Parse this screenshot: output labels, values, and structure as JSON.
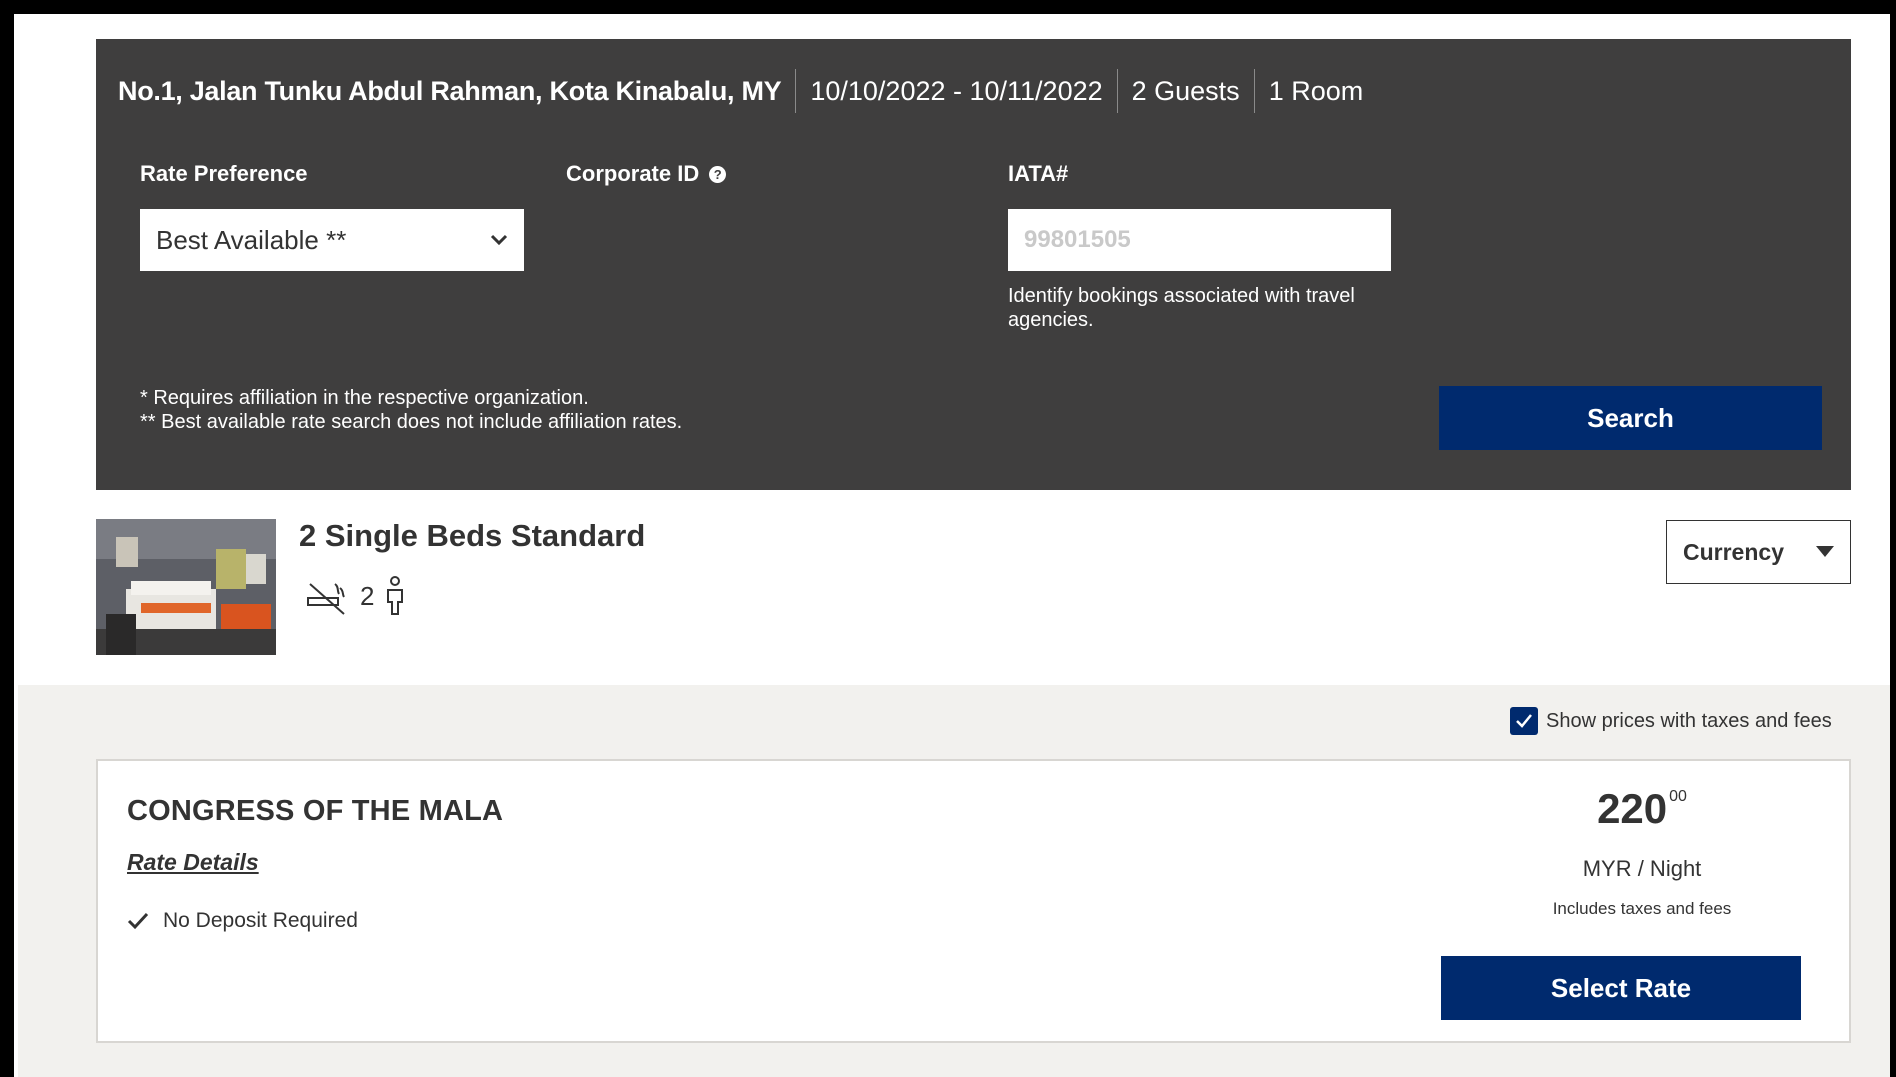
{
  "search": {
    "summary": {
      "address": "No.1, Jalan Tunku Abdul Rahman, Kota Kinabalu, MY",
      "dates": "10/10/2022 - 10/11/2022",
      "guests": "2 Guests",
      "rooms": "1 Room"
    },
    "rate_preference": {
      "label": "Rate Preference",
      "value": "Best Available **"
    },
    "corporate_id": {
      "label": "Corporate ID",
      "help_icon": "question-circle-icon"
    },
    "iata": {
      "label": "IATA#",
      "placeholder": "99801505",
      "hint": "Identify bookings associated with travel agencies."
    },
    "notes": [
      "* Requires affiliation in the respective organization.",
      "** Best available rate search does not include affiliation rates."
    ],
    "search_label": "Search"
  },
  "room": {
    "title": "2 Single Beds Standard",
    "occupancy": "2",
    "icons": [
      "no-smoking-icon",
      "person-icon"
    ]
  },
  "currency": {
    "label": "Currency",
    "icon": "caret-down-icon"
  },
  "tax_toggle": {
    "label": "Show prices with taxes and fees",
    "checked": true
  },
  "rate": {
    "name": "CONGRESS OF THE MALA",
    "details_link": "Rate Details",
    "deposit": "No Deposit Required",
    "price_whole": "220",
    "price_cents": "00",
    "unit": "MYR / Night",
    "tax_note": "Includes taxes and fees",
    "select_label": "Select Rate"
  },
  "colors": {
    "panel_bg": "#3f3e3e",
    "primary_button": "#002a6e",
    "rates_bg": "#f2f1ee"
  }
}
